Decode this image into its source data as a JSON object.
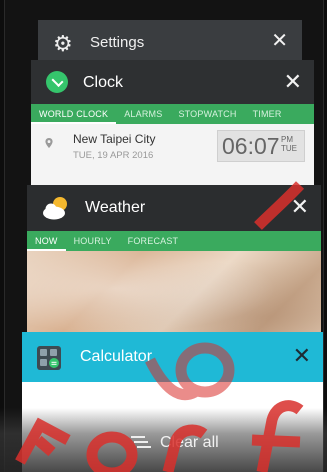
{
  "cards": {
    "settings": {
      "title": "Settings",
      "close": "✕",
      "icon": "gear-icon"
    },
    "clock": {
      "title": "Clock",
      "close": "✕",
      "icon": "clock-app-icon",
      "tabs": [
        "WORLD CLOCK",
        "ALARMS",
        "STOPWATCH",
        "TIMER"
      ],
      "city": "New Taipei City",
      "date": "TUE, 19 APR 2016",
      "time": "06:07",
      "ampm": "PM",
      "day": "TUE"
    },
    "weather": {
      "title": "Weather",
      "close": "✕",
      "icon": "weather-partly-cloudy-icon",
      "tabs": [
        "NOW",
        "HOURLY",
        "FORECAST"
      ]
    },
    "calculator": {
      "title": "Calculator",
      "close": "✕",
      "icon": "calculator-icon"
    }
  },
  "clear_all": {
    "label": "Clear all",
    "icon": "clear-all-icon"
  },
  "colors": {
    "accent_green": "#3aaa5e",
    "calculator_header": "#1fb9d6",
    "watermark": "#d9302c"
  }
}
